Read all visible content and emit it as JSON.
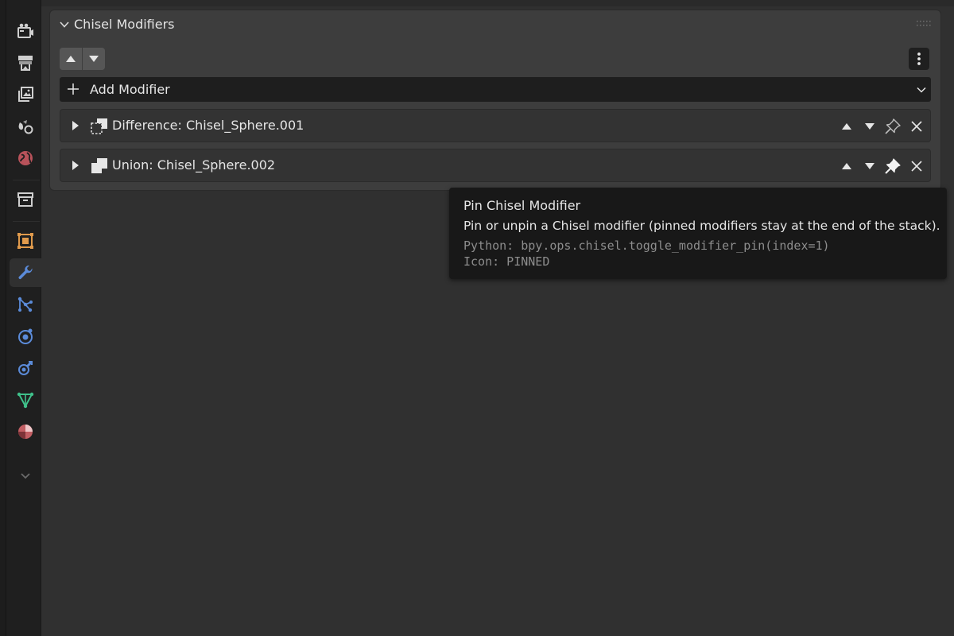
{
  "sidebar": {
    "tabs": [
      {
        "name": "render-icon",
        "active": false
      },
      {
        "name": "output-icon",
        "active": false
      },
      {
        "name": "view-layer-icon",
        "active": false
      },
      {
        "name": "scene-icon",
        "active": false
      },
      {
        "name": "world-icon",
        "active": false
      },
      {
        "name": "collection-icon",
        "active": false
      },
      {
        "name": "object-icon",
        "active": false
      },
      {
        "name": "modifier-wrench-icon",
        "active": true
      },
      {
        "name": "particles-icon",
        "active": false
      },
      {
        "name": "physics-icon",
        "active": false
      },
      {
        "name": "constraints-icon",
        "active": false
      },
      {
        "name": "object-data-icon",
        "active": false
      },
      {
        "name": "material-icon",
        "active": false
      },
      {
        "name": "more-chevron-icon",
        "active": false
      }
    ]
  },
  "panel": {
    "title": "Chisel Modifiers",
    "add_modifier_label": "Add Modifier",
    "modifiers": [
      {
        "label": "Difference: Chisel_Sphere.001",
        "type_icon": "difference-icon",
        "pinned": false
      },
      {
        "label": "Union: Chisel_Sphere.002",
        "type_icon": "union-icon",
        "pinned": true
      }
    ]
  },
  "tooltip": {
    "title": "Pin Chisel Modifier",
    "description": "Pin or unpin a Chisel modifier (pinned modifiers stay at the end of the stack).",
    "python": "Python: bpy.ops.chisel.toggle_modifier_pin(index=1)",
    "icon": "Icon: PINNED"
  },
  "colors": {
    "background": "#303030",
    "panel": "#3d3d3d",
    "tooltip": "#181818",
    "active_tab_icon": "#5b8bd9"
  }
}
